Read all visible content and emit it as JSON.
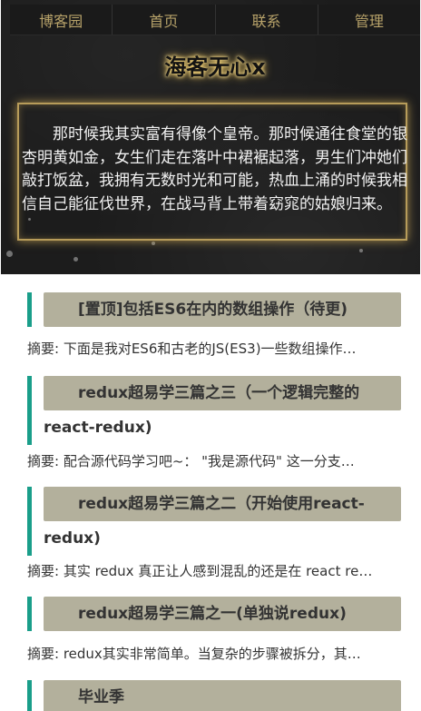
{
  "nav": {
    "items": [
      {
        "label": "博客园"
      },
      {
        "label": "首页"
      },
      {
        "label": "联系"
      },
      {
        "label": "管理"
      }
    ]
  },
  "header": {
    "site_title": "海客无心x",
    "motto": "那时候我其实富有得像个皇帝。那时候通往食堂的银杏明黄如金，女生们走在落叶中裙裾起落，男生们冲她们敲打饭盆，我拥有无数时光和可能，热血上涌的时候我相信自己能征伐世界，在战马背上带着窈窕的姑娘归来。"
  },
  "posts": [
    {
      "title": "[置顶]包括ES6在内的数组操作（待更)",
      "summary": "摘要: 下面是我对ES6和古老的JS(ES3)一些数组操作…"
    },
    {
      "title": "redux超易学三篇之三（一个逻辑完整的react-redux)",
      "summary": "摘要: 配合源代码学习吧~：  \"我是源代码\" 这一分支…"
    },
    {
      "title": "redux超易学三篇之二（开始使用react-redux)",
      "summary": "摘要: 其实 redux 真正让人感到混乱的还是在 react re…"
    },
    {
      "title": "redux超易学三篇之一(单独说redux)",
      "summary": "摘要: redux其实非常简单。当复杂的步骤被拆分，其…"
    },
    {
      "title": "毕业季",
      "summary": ""
    }
  ],
  "colors": {
    "accent_bar": "#1a9e8a",
    "title_bg": "#b3b09c",
    "nav_text": "#b8a36a",
    "motto_border": "#b79c5a"
  }
}
